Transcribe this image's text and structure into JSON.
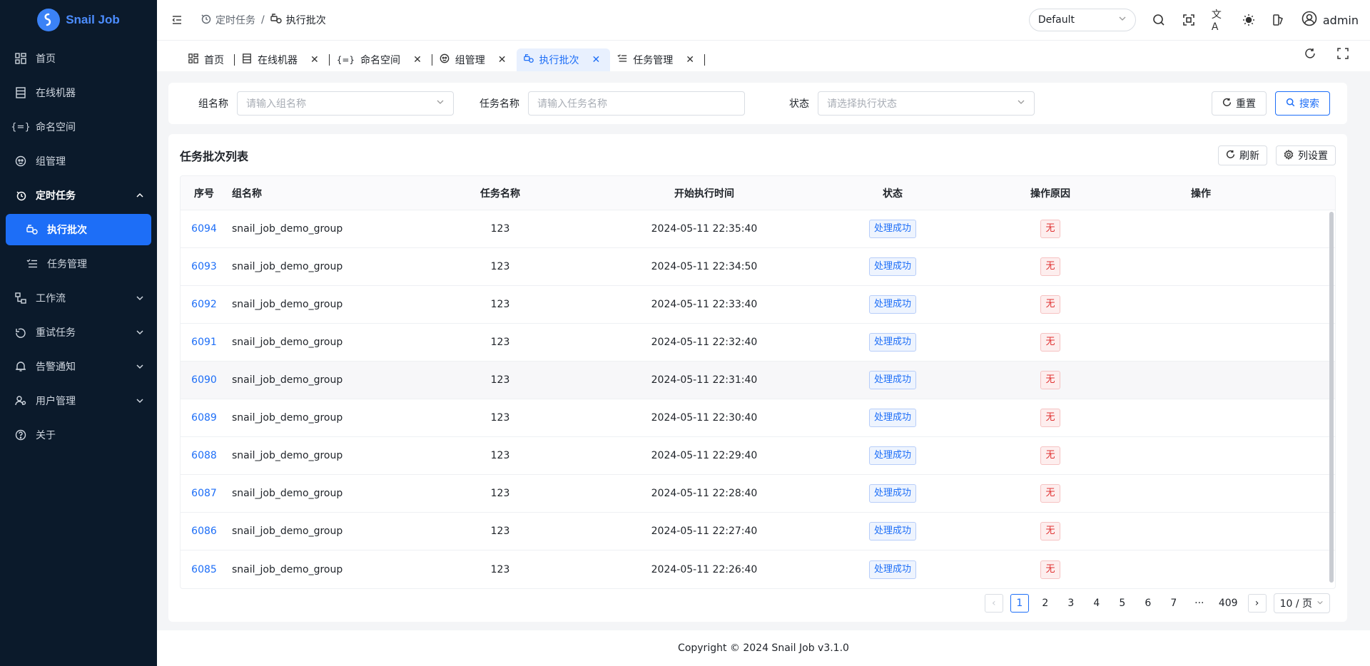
{
  "app": {
    "name": "Snail Job",
    "brand_color": "#1d6ef7",
    "sidebar_bg": "#0b1a2b"
  },
  "sidebar": {
    "items": [
      {
        "label": "首页",
        "icon": "dashboard-icon"
      },
      {
        "label": "在线机器",
        "icon": "server-icon"
      },
      {
        "label": "命名空间",
        "icon": "braces-icon"
      },
      {
        "label": "组管理",
        "icon": "group-icon"
      },
      {
        "label": "定时任务",
        "icon": "timer-icon",
        "expanded": true
      },
      {
        "label": "执行批次",
        "icon": "batch-icon",
        "active": true
      },
      {
        "label": "任务管理",
        "icon": "task-list-icon"
      },
      {
        "label": "工作流",
        "icon": "workflow-icon"
      },
      {
        "label": "重试任务",
        "icon": "retry-icon"
      },
      {
        "label": "告警通知",
        "icon": "bell-icon"
      },
      {
        "label": "用户管理",
        "icon": "user-manage-icon"
      },
      {
        "label": "关于",
        "icon": "help-icon"
      }
    ]
  },
  "header": {
    "breadcrumb": [
      "定时任务",
      "执行批次"
    ],
    "separator": "/",
    "theme": "Default",
    "username": "admin"
  },
  "tabs": [
    {
      "label": "首页",
      "closable": false
    },
    {
      "label": "在线机器",
      "closable": true
    },
    {
      "label": "命名空间",
      "closable": true
    },
    {
      "label": "组管理",
      "closable": true
    },
    {
      "label": "执行批次",
      "closable": true,
      "active": true
    },
    {
      "label": "任务管理",
      "closable": true
    }
  ],
  "search": {
    "group_label": "组名称",
    "group_placeholder": "请输入组名称",
    "task_label": "任务名称",
    "task_placeholder": "请输入任务名称",
    "status_label": "状态",
    "status_placeholder": "请选择执行状态",
    "reset": "重置",
    "search": "搜索"
  },
  "table": {
    "title": "任务批次列表",
    "refresh": "刷新",
    "column_settings": "列设置",
    "columns": [
      "序号",
      "组名称",
      "任务名称",
      "开始执行时间",
      "状态",
      "操作原因",
      "操作"
    ],
    "rows": [
      {
        "id": "6094",
        "group": "snail_job_demo_group",
        "task": "123",
        "time": "2024-05-11 22:35:40",
        "status": "处理成功",
        "reason": "无"
      },
      {
        "id": "6093",
        "group": "snail_job_demo_group",
        "task": "123",
        "time": "2024-05-11 22:34:50",
        "status": "处理成功",
        "reason": "无"
      },
      {
        "id": "6092",
        "group": "snail_job_demo_group",
        "task": "123",
        "time": "2024-05-11 22:33:40",
        "status": "处理成功",
        "reason": "无"
      },
      {
        "id": "6091",
        "group": "snail_job_demo_group",
        "task": "123",
        "time": "2024-05-11 22:32:40",
        "status": "处理成功",
        "reason": "无"
      },
      {
        "id": "6090",
        "group": "snail_job_demo_group",
        "task": "123",
        "time": "2024-05-11 22:31:40",
        "status": "处理成功",
        "reason": "无"
      },
      {
        "id": "6089",
        "group": "snail_job_demo_group",
        "task": "123",
        "time": "2024-05-11 22:30:40",
        "status": "处理成功",
        "reason": "无"
      },
      {
        "id": "6088",
        "group": "snail_job_demo_group",
        "task": "123",
        "time": "2024-05-11 22:29:40",
        "status": "处理成功",
        "reason": "无"
      },
      {
        "id": "6087",
        "group": "snail_job_demo_group",
        "task": "123",
        "time": "2024-05-11 22:28:40",
        "status": "处理成功",
        "reason": "无"
      },
      {
        "id": "6086",
        "group": "snail_job_demo_group",
        "task": "123",
        "time": "2024-05-11 22:27:40",
        "status": "处理成功",
        "reason": "无"
      },
      {
        "id": "6085",
        "group": "snail_job_demo_group",
        "task": "123",
        "time": "2024-05-11 22:26:40",
        "status": "处理成功",
        "reason": "无"
      }
    ]
  },
  "pagination": {
    "pages": [
      "1",
      "2",
      "3",
      "4",
      "5",
      "6",
      "7",
      "···",
      "409"
    ],
    "current": "1",
    "page_size": "10 / 页"
  },
  "footer": {
    "text": "Copyright © 2024 Snail Job v3.1.0"
  }
}
